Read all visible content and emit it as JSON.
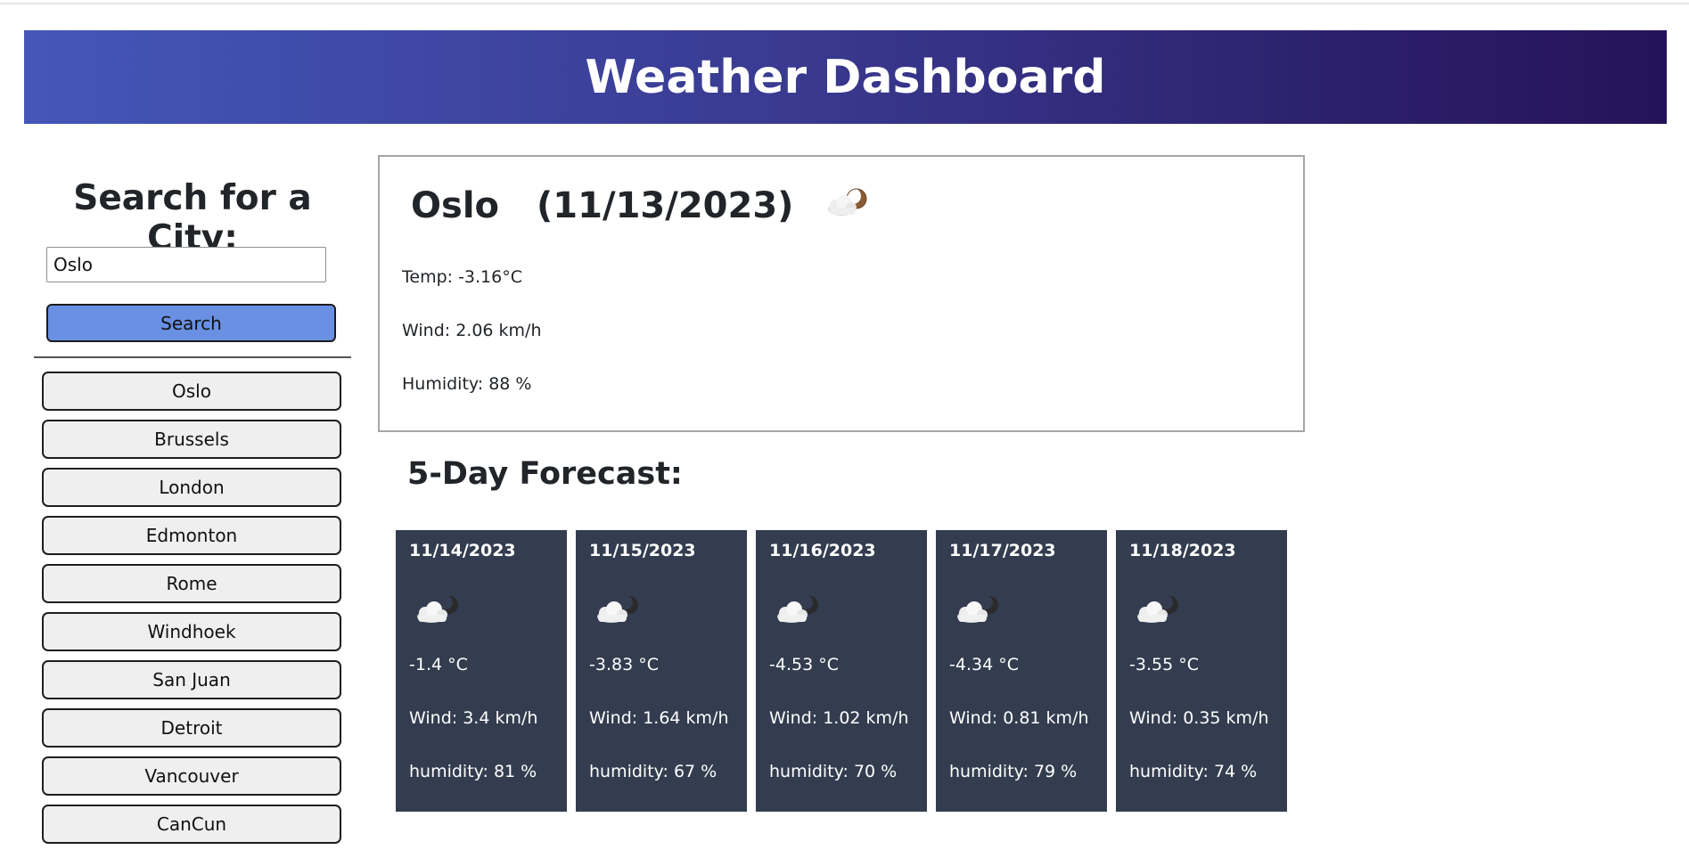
{
  "header": {
    "title": "Weather Dashboard"
  },
  "search": {
    "title": "Search for a City:",
    "input_value": "Oslo",
    "button_label": "Search"
  },
  "history": {
    "items": [
      "Oslo",
      "Brussels",
      "London",
      "Edmonton",
      "Rome",
      "Windhoek",
      "San Juan",
      "Detroit",
      "Vancouver",
      "CanCun"
    ]
  },
  "current": {
    "city": "Oslo",
    "date": "(11/13/2023)",
    "icon": "cloud-moon-icon",
    "temp": "Temp: -3.16°C",
    "wind": "Wind: 2.06 km/h",
    "humidity": "Humidity: 88 %"
  },
  "forecast": {
    "title": "5-Day Forecast:",
    "days": [
      {
        "date": "11/14/2023",
        "icon": "cloud-moon-icon",
        "temp": "-1.4 °C",
        "wind": "Wind: 3.4 km/h",
        "humidity": "humidity: 81 %"
      },
      {
        "date": "11/15/2023",
        "icon": "cloud-moon-icon",
        "temp": "-3.83 °C",
        "wind": "Wind: 1.64 km/h",
        "humidity": "humidity: 67 %"
      },
      {
        "date": "11/16/2023",
        "icon": "cloud-moon-icon",
        "temp": "-4.53 °C",
        "wind": "Wind: 1.02 km/h",
        "humidity": "humidity: 70 %"
      },
      {
        "date": "11/17/2023",
        "icon": "cloud-moon-icon",
        "temp": "-4.34 °C",
        "wind": "Wind: 0.81 km/h",
        "humidity": "humidity: 79 %"
      },
      {
        "date": "11/18/2023",
        "icon": "cloud-moon-icon",
        "temp": "-3.55 °C",
        "wind": "Wind: 0.35 km/h",
        "humidity": "humidity: 74 %"
      }
    ]
  },
  "colors": {
    "header_start": "#4456b9",
    "header_end": "#26125a",
    "search_button": "#6990e3",
    "forecast_card": "#333d4f"
  }
}
